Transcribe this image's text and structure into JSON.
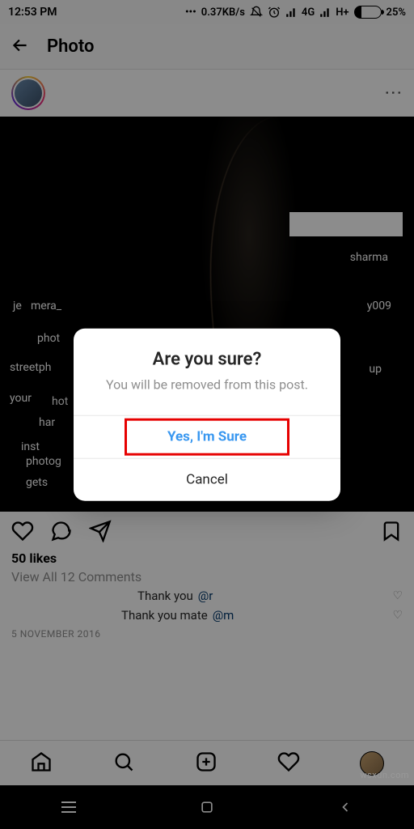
{
  "status": {
    "time": "12:53 PM",
    "net_speed": "0.37KB/s",
    "net_type_1": "4G",
    "net_type_2": "H+",
    "battery_pct": "25%"
  },
  "header": {
    "title": "Photo"
  },
  "post": {
    "tags": {
      "t1": "mera_",
      "t2": "phot",
      "t3": "streetph",
      "t4": "your",
      "t5": "hot",
      "t6": "har",
      "t7": "inst",
      "t8": "photog",
      "t9": "gets",
      "t10": "je",
      "t11": "sharma",
      "t12": "y009",
      "t13": "up"
    },
    "likes": "50 likes",
    "view_comments": "View All 12 Comments",
    "c1_text": "Thank you ",
    "c1_mention": "@r",
    "c2_text": "Thank you mate ",
    "c2_mention": "@m",
    "date": "5 NOVEMBER 2016"
  },
  "dialog": {
    "title": "Are you sure?",
    "message": "You will be removed from this post.",
    "confirm": "Yes, I'm Sure",
    "cancel": "Cancel"
  },
  "watermark": "wsxdn.com"
}
